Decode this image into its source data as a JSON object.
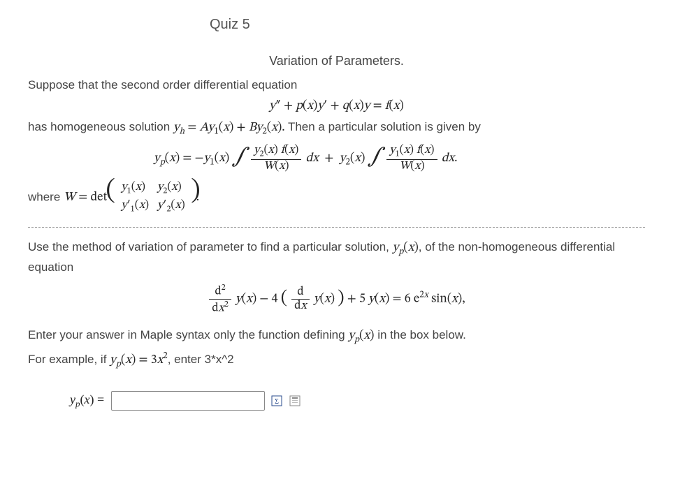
{
  "quiz_title": "Quiz 5",
  "section_title": "Variation of Parameters.",
  "intro": {
    "line1": "Suppose that the second order differential equation",
    "eq1": "y″ + p(x)y′ + q(x)y = f(x)",
    "line2_pre": "has homogeneous solution ",
    "line2_math": "yₕ = A y₁(x) + B y₂(x).",
    "line2_post": " Then a particular solution is given by",
    "yp_formula": {
      "lhs": "yₚ(x) = −y₁(x)",
      "frac1_num": "y₂(x) f(x)",
      "frac1_den": "W(x)",
      "mid": "dx  +  y₂(x)",
      "frac2_num": "y₁(x) f(x)",
      "frac2_den": "W(x)",
      "end": "dx."
    },
    "where_pre": "where ",
    "where_math": "W = det",
    "matrix": {
      "a11": "y₁(x)",
      "a12": "y₂(x)",
      "a21": "y₁′(x)",
      "a22": "y₂′(x)"
    },
    "where_post": "."
  },
  "problem": {
    "line1_pre": "Use the method of variation of parameter to find a particular solution, ",
    "line1_math": "yₚ(x)",
    "line1_post": ", of the non-homogeneous differential equation",
    "ode": {
      "frac1_num": "d²",
      "frac1_den": "dx²",
      "mid1": " y(x) − 4 ",
      "frac2_num": "d",
      "frac2_den": "dx",
      "mid2": " y(x)",
      "rhs": " + 5 y(x) = 6 e²ˣ sin(x),"
    },
    "instr1_pre": "Enter your answer in Maple syntax only the function defining ",
    "instr1_math": "yₚ(x)",
    "instr1_post": " in the box below.",
    "instr2_pre": "For example, if ",
    "instr2_math": "yₚ(x) = 3x²",
    "instr2_post": ", enter 3*x^2"
  },
  "answer": {
    "label": "yₚ(x) =",
    "value": "",
    "placeholder": ""
  },
  "icons": {
    "eq_editor": "equation-editor-icon",
    "preview": "preview-icon"
  }
}
